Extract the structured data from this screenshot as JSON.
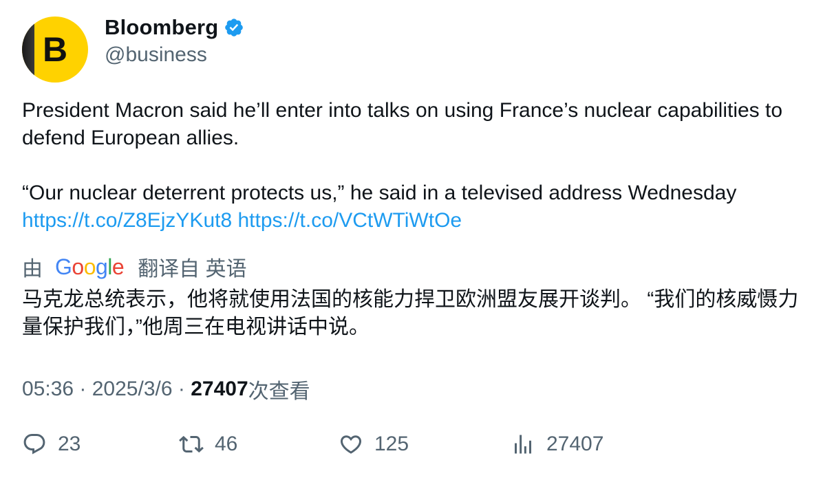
{
  "author": {
    "name": "Bloomberg",
    "handle": "@business",
    "avatar_letter": "B",
    "verified_color": "#1d9bf0",
    "avatar_color": "#ffd200"
  },
  "tweet": {
    "text_line1": "President Macron said he’ll enter into talks on using France’s nuclear capabilities to defend European allies.",
    "text_line2": "“Our nuclear deterrent protects us,” he said in a televised address Wednesday",
    "link1": "https://t.co/Z8EjzYKut8",
    "link2": "https://t.co/VCtWTiWtOe"
  },
  "translation": {
    "by_label": "由",
    "provider": "Google",
    "from_label": "翻译自 英语",
    "text": "马克龙总统表示，他将就使用法国的核能力捍卫欧洲盟友展开谈判。 “我们的核威慑力量保护我们，”他周三在电视讲话中说。"
  },
  "meta": {
    "time": "05:36",
    "sep1": " · ",
    "date": "2025/3/6",
    "sep2": " · ",
    "views_count": "27407",
    "views_label": "次查看"
  },
  "actions": {
    "replies": "23",
    "retweets": "46",
    "likes": "125",
    "views": "27407"
  }
}
